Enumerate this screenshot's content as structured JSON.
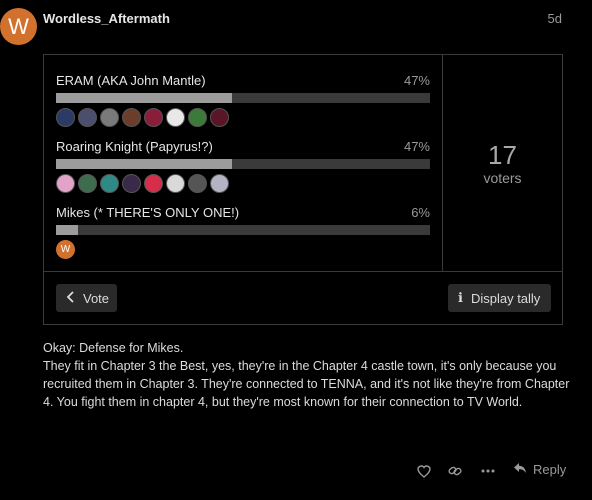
{
  "post": {
    "author_initial": "W",
    "author": "Wordless_Aftermath",
    "age": "5d"
  },
  "poll": {
    "options": [
      {
        "label": "ERAM (AKA John Mantle)",
        "percent_text": "47%",
        "percent": 47,
        "voter_count_shown": 8
      },
      {
        "label": "Roaring Knight (Papyrus!?)",
        "percent_text": "47%",
        "percent": 47,
        "voter_count_shown": 8
      },
      {
        "label": "Mikes (* THERE'S ONLY ONE!)",
        "percent_text": "6%",
        "percent": 6,
        "voter_count_shown": 1
      }
    ],
    "total_voters": "17",
    "voters_label": "voters",
    "vote_button": "Vote",
    "tally_button": "Display tally"
  },
  "body": {
    "line1": "Okay: Defense for Mikes.",
    "line2": "They fit in Chapter 3 the Best, yes, they're in the Chapter 4 castle town, it's only because you recruited them in Chapter 3. They're connected to TENNA, and it's not like they're from Chapter 4. You fight them in chapter 4, but they're most known for their connection to TV World."
  },
  "actions": {
    "reply_label": "Reply",
    "icons": [
      "heart-icon",
      "link-icon",
      "more-icon",
      "reply-icon"
    ]
  },
  "colors": {
    "accent_avatar": "#d2712e",
    "bar_fill": "#9c9c9c",
    "bar_track": "#3a3a3a"
  }
}
